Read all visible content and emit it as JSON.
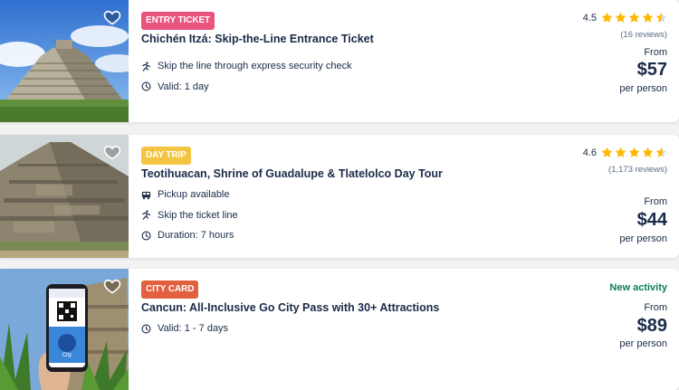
{
  "colors": {
    "badge_entry_ticket": "#e8557e",
    "badge_day_trip": "#f4c542",
    "badge_city_card": "#e2603f",
    "star": "#ffb800",
    "text_primary": "#1a2b49",
    "new_activity": "#0a7b5e"
  },
  "listings": [
    {
      "badge": "ENTRY TICKET",
      "title": "Chichén Itzá: Skip-the-Line Entrance Ticket",
      "features": [
        {
          "icon": "skip-line-icon",
          "text": "Skip the line through express security check"
        },
        {
          "icon": "clock-icon",
          "text": "Valid: 1 day"
        }
      ],
      "rating": 4.5,
      "rating_text": "4.5",
      "reviews": "(16 reviews)",
      "from_label": "From",
      "price": "$57",
      "per_label": "per person"
    },
    {
      "badge": "DAY TRIP",
      "title": "Teotihuacan, Shrine of Guadalupe & Tlatelolco Day Tour",
      "features": [
        {
          "icon": "bus-icon",
          "text": "Pickup available"
        },
        {
          "icon": "skip-line-icon",
          "text": "Skip the ticket line"
        },
        {
          "icon": "clock-icon",
          "text": "Duration: 7 hours"
        }
      ],
      "rating": 4.6,
      "rating_text": "4.6",
      "reviews": "(1,173 reviews)",
      "from_label": "From",
      "price": "$44",
      "per_label": "per person"
    },
    {
      "badge": "CITY CARD",
      "title": "Cancun: All-Inclusive Go City Pass with 30+ Attractions",
      "features": [
        {
          "icon": "clock-icon",
          "text": "Valid: 1 - 7 days"
        }
      ],
      "new_activity": "New activity",
      "from_label": "From",
      "price": "$89",
      "per_label": "per person",
      "phone_screen_text": "City"
    }
  ]
}
